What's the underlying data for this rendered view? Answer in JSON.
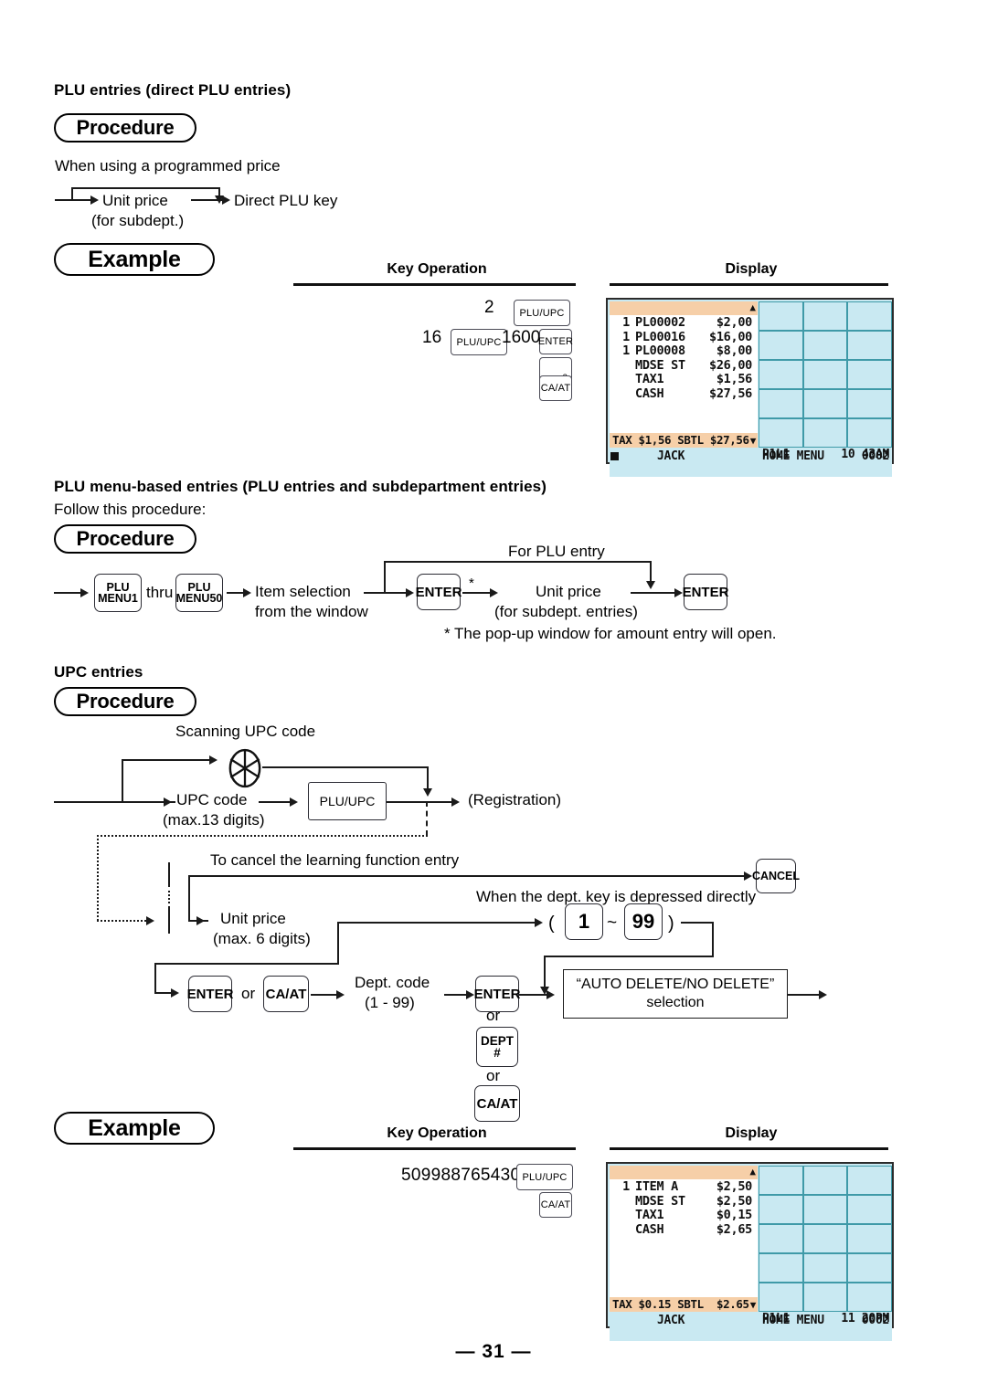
{
  "page": {
    "number_label": "— 31 —"
  },
  "section1": {
    "heading": "PLU entries (direct PLU entries)",
    "procedure_badge": "Procedure",
    "note": "When using a programmed price",
    "flow": {
      "unit_price": "Unit price",
      "unit_price_sub": "(for subdept.)",
      "direct_plu_key": "Direct PLU key"
    },
    "example_badge": "Example",
    "col_key_operation": "Key Operation",
    "col_display": "Display",
    "key_operation": {
      "qty_2": "2",
      "key_pluupc_1": "PLU/UPC",
      "qty_16": "16",
      "key_pluupc_2": "PLU/UPC",
      "amount_1600": "1600",
      "key_enter": "ENTER",
      "key_direct_plu_number": "8",
      "key_caat": "CA/AT"
    },
    "display": {
      "lines": [
        {
          "qty": "1",
          "name": "PL00002",
          "amount": "$2,00"
        },
        {
          "qty": "1",
          "name": "PL00016",
          "amount": "$16,00"
        },
        {
          "qty": "1",
          "name": "PL00008",
          "amount": "$8,00"
        },
        {
          "qty": "",
          "name": "MDSE ST",
          "amount": "$26,00"
        },
        {
          "qty": "",
          "name": "TAX1",
          "amount": "$1,56"
        },
        {
          "qty": "",
          "name": "CASH",
          "amount": "$27,56"
        }
      ],
      "tax_bar": "TAX $1,56 SBTL $27,56",
      "scroll_up_caret": "▲",
      "scroll_down_caret": "▼",
      "footer_clerk": "JACK",
      "footer_menu": "HOME MENU",
      "footer_counter": "0002",
      "footer_level": "P1L1",
      "footer_time": "10 43AM"
    }
  },
  "section2": {
    "heading": "PLU menu-based entries (PLU entries and subdepartment entries)",
    "intro": "Follow this procedure:",
    "procedure_badge": "Procedure",
    "flow": {
      "key_plu_menu1_l1": "PLU",
      "key_plu_menu1_l2": "MENU1",
      "thru": "thru",
      "key_plu_menu50_l1": "PLU",
      "key_plu_menu50_l2": "MENU50",
      "item_selection_l1": "Item selection",
      "item_selection_l2": "from the window",
      "key_enter_1": "ENTER",
      "asterisk": "*",
      "for_plu_entry": "For PLU entry",
      "unit_price_l1": "Unit price",
      "unit_price_l2": "(for subdept. entries)",
      "key_enter_2": "ENTER"
    },
    "footnote": "*  The pop-up window for amount entry will open."
  },
  "section3": {
    "heading": "UPC entries",
    "procedure_badge": "Procedure",
    "flow": {
      "scanning_upc_code": "Scanning UPC code",
      "scanner_icon": "barcode-scanner-icon",
      "upc_code_l1": "UPC code",
      "upc_code_l2": "(max.13 digits)",
      "key_pluupc": "PLU/UPC",
      "registration": "(Registration)",
      "cancel_note": "To cancel the learning function entry",
      "key_cancel": "CANCEL",
      "dept_direct_note": "When the dept. key is depressed directly",
      "unit_price_l1": "Unit price",
      "unit_price_l2": "(max. 6 digits)",
      "paren_open": "(",
      "key_num_1": "1",
      "tilde": "~",
      "key_num_99": "99",
      "paren_close": ")",
      "key_enter_1": "ENTER",
      "or_1": "or",
      "key_caat_1": "CA/AT",
      "dept_code_l1": "Dept. code",
      "dept_code_l2": "(1 - 99)",
      "key_enter_2": "ENTER",
      "or_2": "or",
      "key_dept_l1": "DEPT",
      "key_dept_l2": "#",
      "or_3": "or",
      "key_caat_2": "CA/AT",
      "auto_delete_l1": "“AUTO DELETE/NO DELETE”",
      "auto_delete_l2": "selection"
    },
    "example_badge": "Example",
    "col_key_operation": "Key Operation",
    "col_display": "Display",
    "key_operation": {
      "upc_number": "5099887654302",
      "key_pluupc": "PLU/UPC",
      "key_caat": "CA/AT"
    },
    "display": {
      "lines": [
        {
          "qty": "1",
          "name": "ITEM A",
          "amount": "$2,50"
        },
        {
          "qty": "",
          "name": "MDSE ST",
          "amount": "$2,50"
        },
        {
          "qty": "",
          "name": "TAX1",
          "amount": "$0,15"
        },
        {
          "qty": "",
          "name": "CASH",
          "amount": "$2,65"
        }
      ],
      "tax_bar": "TAX $0.15 SBTL  $2.65",
      "scroll_up_caret": "▲",
      "scroll_down_caret": "▼",
      "footer_clerk": "JACK",
      "footer_menu": "HOME MENU",
      "footer_counter": "0002",
      "footer_level": "P1L1",
      "footer_time": "11 20PM"
    }
  },
  "colors": {
    "display_grid": "#c9e9f2",
    "display_grid_border": "#3f9aa8",
    "display_bar": "#f6cfa8",
    "ink": "#111111"
  }
}
